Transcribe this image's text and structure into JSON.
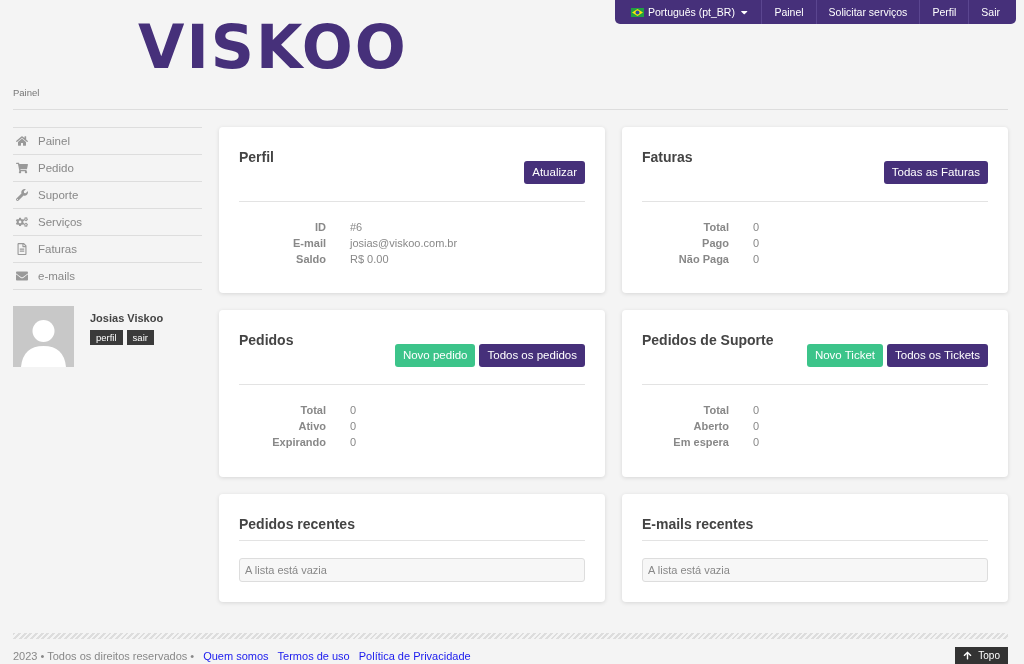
{
  "nav": {
    "language": "Português (pt_BR)",
    "items": [
      "Painel",
      "Solicitar serviços",
      "Perfil",
      "Sair"
    ]
  },
  "logo": "VISKOO",
  "breadcrumb": "Painel",
  "sidebar": {
    "items": [
      {
        "label": "Painel"
      },
      {
        "label": "Pedido"
      },
      {
        "label": "Suporte"
      },
      {
        "label": "Serviços"
      },
      {
        "label": "Faturas"
      },
      {
        "label": "e-mails"
      }
    ]
  },
  "user": {
    "name": "Josias Viskoo",
    "buttons": [
      "perfil",
      "sair"
    ]
  },
  "cards": [
    {
      "title": "Perfil",
      "buttons": [
        {
          "label": "Atualizar",
          "kind": "primary"
        }
      ],
      "rows": [
        {
          "label": "ID",
          "value": "#6"
        },
        {
          "label": "E-mail",
          "value": "josias@viskoo.com.br"
        },
        {
          "label": "Saldo",
          "value": "R$ 0.00"
        }
      ]
    },
    {
      "title": "Faturas",
      "buttons": [
        {
          "label": "Todas as Faturas",
          "kind": "primary"
        }
      ],
      "rows": [
        {
          "label": "Total",
          "value": "0"
        },
        {
          "label": "Pago",
          "value": "0"
        },
        {
          "label": "Não Paga",
          "value": "0"
        }
      ]
    },
    {
      "title": "Pedidos",
      "buttons": [
        {
          "label": "Novo pedido",
          "kind": "success"
        },
        {
          "label": "Todos os pedidos",
          "kind": "primary"
        }
      ],
      "rows": [
        {
          "label": "Total",
          "value": "0"
        },
        {
          "label": "Ativo",
          "value": "0"
        },
        {
          "label": "Expirando",
          "value": "0"
        }
      ]
    },
    {
      "title": "Pedidos de Suporte",
      "buttons": [
        {
          "label": "Novo Ticket",
          "kind": "success"
        },
        {
          "label": "Todos os Tickets",
          "kind": "primary"
        }
      ],
      "rows": [
        {
          "label": "Total",
          "value": "0"
        },
        {
          "label": "Aberto",
          "value": "0"
        },
        {
          "label": "Em espera",
          "value": "0"
        }
      ]
    }
  ],
  "recent": [
    {
      "title": "Pedidos recentes",
      "empty": "A lista está vazia"
    },
    {
      "title": "E-mails recentes",
      "empty": "A lista está vazia"
    }
  ],
  "footer": {
    "copyright": "2023 • Todos os direitos reservados •",
    "links": [
      "Quem somos",
      "Termos de uso",
      "Política de Privacidade"
    ],
    "top": "Topo"
  }
}
